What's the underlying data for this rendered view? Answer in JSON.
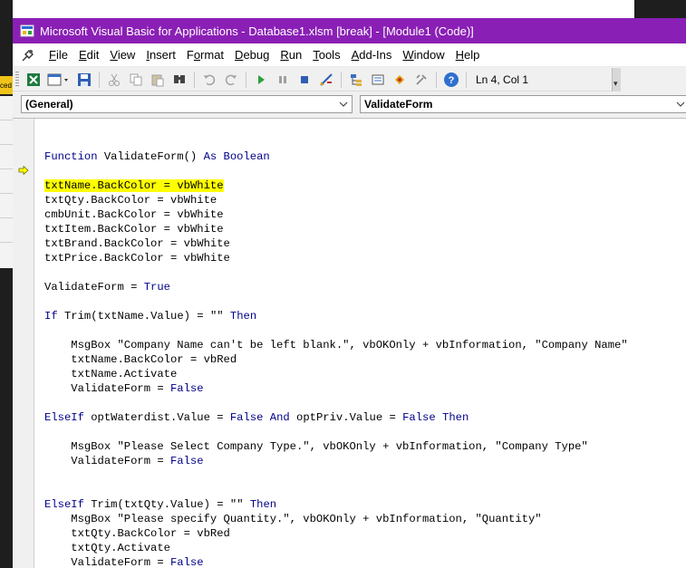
{
  "window": {
    "title": "Microsoft Visual Basic for Applications - Database1.xlsm [break] - [Module1 (Code)]"
  },
  "menu": [
    "File",
    "Edit",
    "View",
    "Insert",
    "Format",
    "Debug",
    "Run",
    "Tools",
    "Add-Ins",
    "Window",
    "Help"
  ],
  "menu_underline": [
    "F",
    "E",
    "V",
    "I",
    "o",
    "D",
    "R",
    "T",
    "A",
    "W",
    "H"
  ],
  "toolbar": {
    "status": "Ln 4, Col 1"
  },
  "combos": {
    "object": "(General)",
    "procedure": "ValidateForm"
  },
  "background": {
    "edge_text": "ced"
  },
  "colors": {
    "titlebar": "#8a1fb5",
    "keyword": "#00008b",
    "highlight": "#ffff00"
  },
  "code_lines": [
    "",
    "Function ValidateForm() As Boolean",
    "",
    "txtName.BackColor = vbWhite",
    "txtQty.BackColor = vbWhite",
    "cmbUnit.BackColor = vbWhite",
    "txtItem.BackColor = vbWhite",
    "txtBrand.BackColor = vbWhite",
    "txtPrice.BackColor = vbWhite",
    "",
    "ValidateForm = True",
    "",
    "If Trim(txtName.Value) = \"\" Then",
    "",
    "    MsgBox \"Company Name can't be left blank.\", vbOKOnly + vbInformation, \"Company Name\"",
    "    txtName.BackColor = vbRed",
    "    txtName.Activate",
    "    ValidateForm = False",
    "",
    "ElseIf optWaterdist.Value = False And optPriv.Value = False Then",
    "",
    "    MsgBox \"Please Select Company Type.\", vbOKOnly + vbInformation, \"Company Type\"",
    "    ValidateForm = False",
    "",
    "",
    "ElseIf Trim(txtQty.Value) = \"\" Then",
    "    MsgBox \"Please specify Quantity.\", vbOKOnly + vbInformation, \"Quantity\"",
    "    txtQty.BackColor = vbRed",
    "    txtQty.Activate",
    "    ValidateForm = False"
  ],
  "current_line": 3
}
